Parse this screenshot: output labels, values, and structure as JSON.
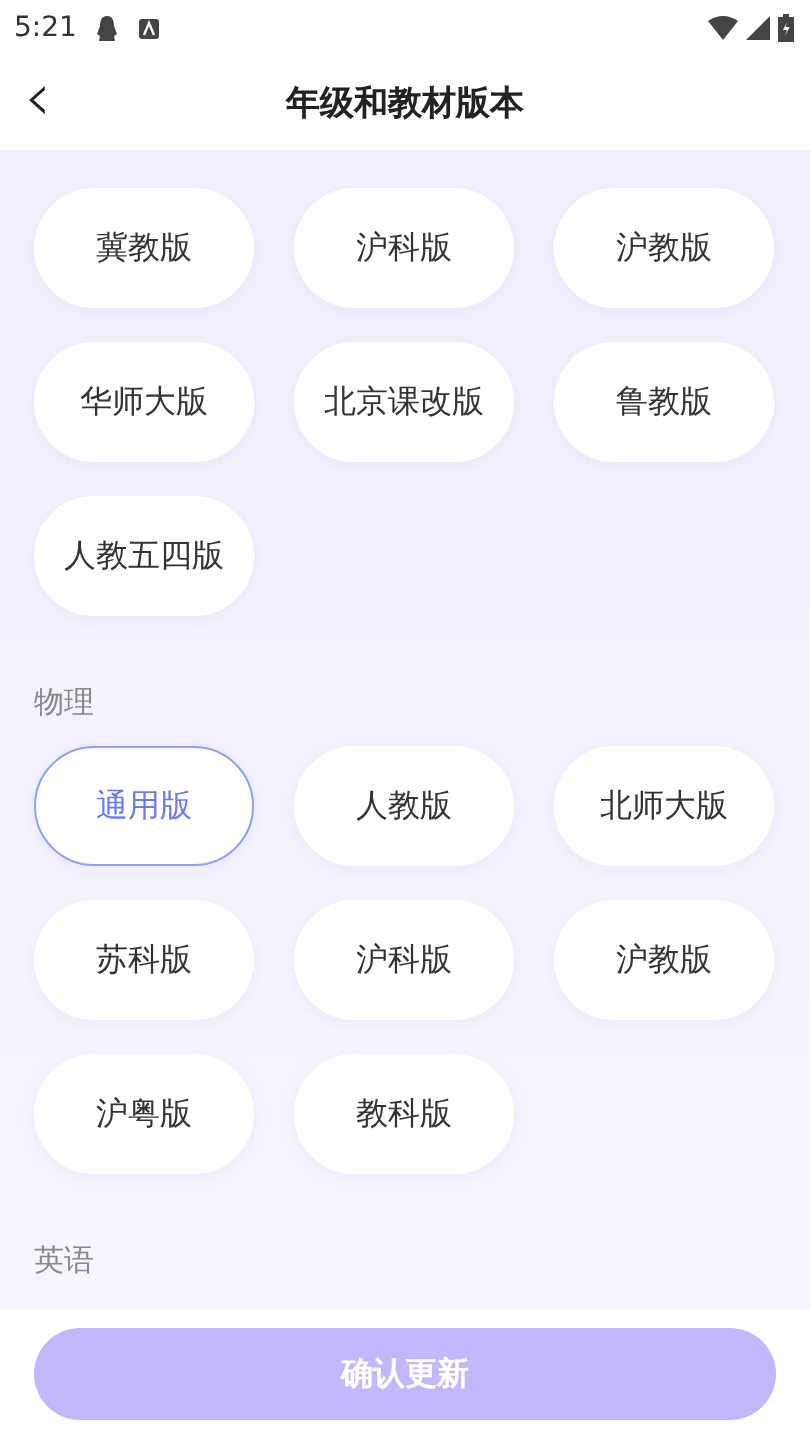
{
  "status_bar": {
    "time": "5:21"
  },
  "header": {
    "back_icon": "‹",
    "title": "年级和教材版本"
  },
  "sections": [
    {
      "options": [
        {
          "label": "冀教版",
          "selected": false
        },
        {
          "label": "沪科版",
          "selected": false
        },
        {
          "label": "沪教版",
          "selected": false
        },
        {
          "label": "华师大版",
          "selected": false
        },
        {
          "label": "北京课改版",
          "selected": false
        },
        {
          "label": "鲁教版",
          "selected": false
        },
        {
          "label": "人教五四版",
          "selected": false
        }
      ]
    },
    {
      "title": "物理",
      "options": [
        {
          "label": "通用版",
          "selected": true
        },
        {
          "label": "人教版",
          "selected": false
        },
        {
          "label": "北师大版",
          "selected": false
        },
        {
          "label": "苏科版",
          "selected": false
        },
        {
          "label": "沪科版",
          "selected": false
        },
        {
          "label": "沪教版",
          "selected": false
        },
        {
          "label": "沪粤版",
          "selected": false
        },
        {
          "label": "教科版",
          "selected": false
        }
      ]
    },
    {
      "title": "英语"
    }
  ],
  "confirm_button": {
    "label": "确认更新",
    "disabled": true
  }
}
